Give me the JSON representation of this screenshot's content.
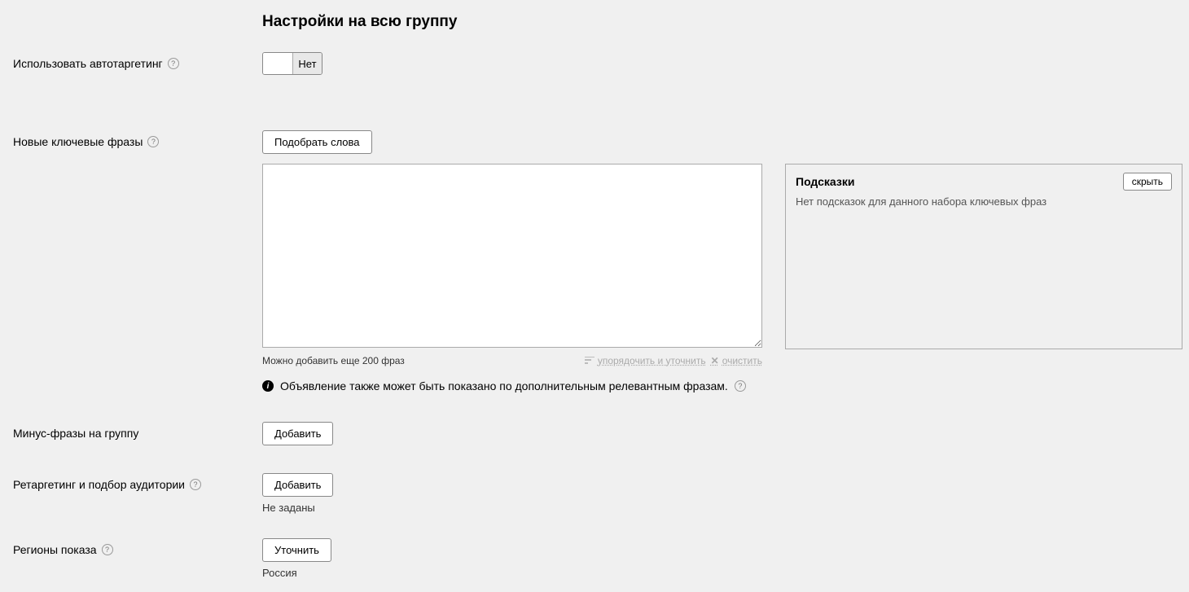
{
  "heading": "Настройки на всю группу",
  "autotargeting": {
    "label": "Использовать автотаргетинг",
    "toggle_off": "Нет"
  },
  "keywords": {
    "label": "Новые ключевые фразы",
    "suggest_btn": "Подобрать слова",
    "remaining": "Можно добавить еще 200 фраз",
    "sort_action": "упорядочить и уточнить",
    "clear_action": "очистить",
    "info_text": "Объявление также может быть показано по дополнительным релевантным фразам."
  },
  "hints": {
    "title": "Подсказки",
    "hide": "скрыть",
    "empty": "Нет подсказок для данного набора ключевых фраз"
  },
  "minus": {
    "label": "Минус-фразы на группу",
    "btn": "Добавить"
  },
  "retargeting": {
    "label": "Ретаргетинг и подбор аудитории",
    "btn": "Добавить",
    "status": "Не заданы"
  },
  "regions": {
    "label": "Регионы показа",
    "btn": "Уточнить",
    "value": "Россия"
  }
}
